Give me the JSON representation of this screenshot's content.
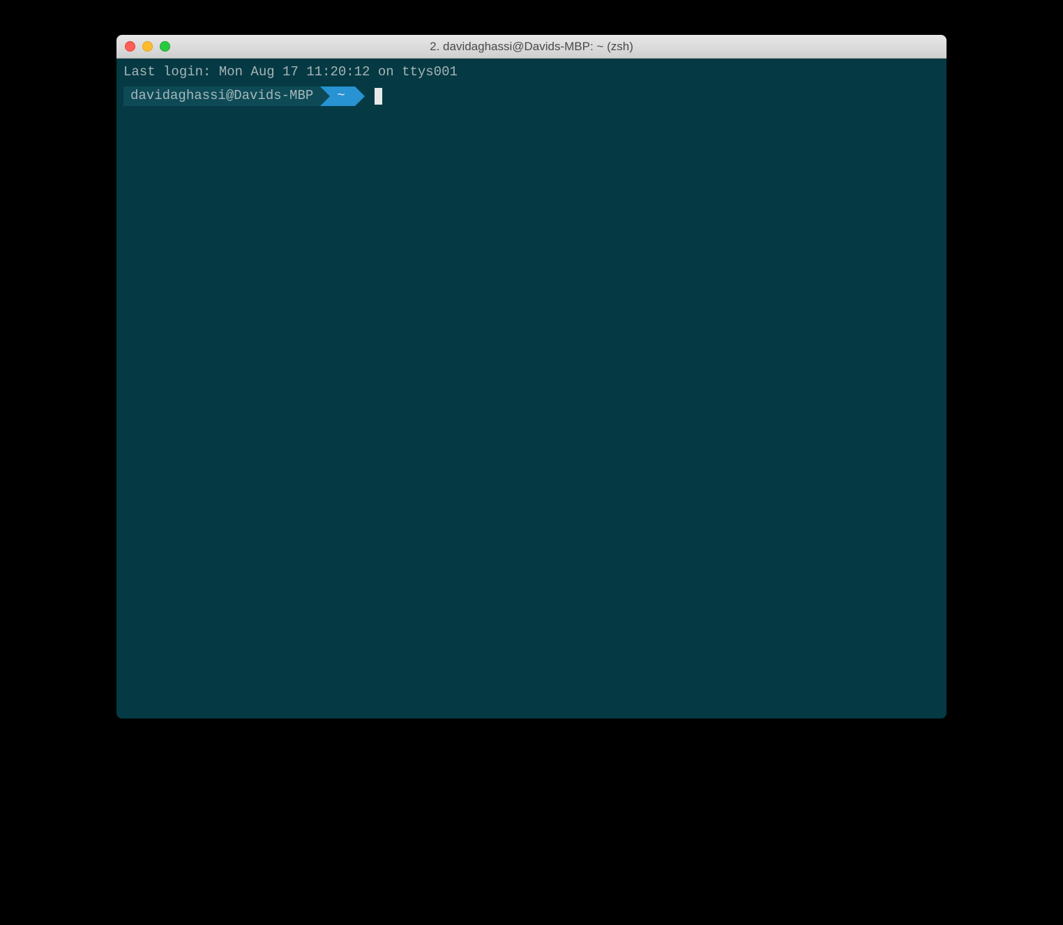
{
  "window": {
    "title": "2. davidaghassi@Davids-MBP: ~ (zsh)"
  },
  "terminal": {
    "last_login": "Last login: Mon Aug 17 11:20:12 on ttys001",
    "prompt": {
      "user_host": "davidaghassi@Davids-MBP",
      "path": "~"
    }
  }
}
